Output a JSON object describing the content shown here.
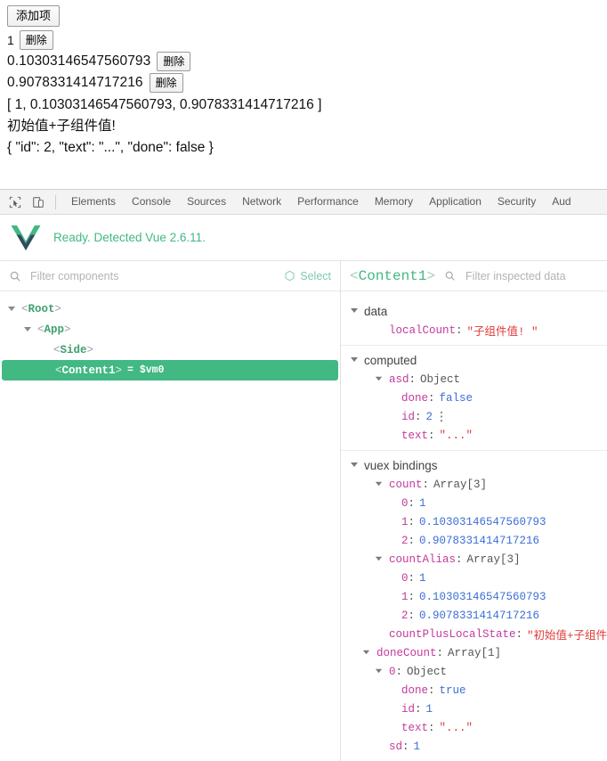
{
  "page": {
    "add_button_label": "添加项",
    "items": [
      {
        "index": "1",
        "value": "",
        "delete_label": "删除"
      },
      {
        "index": "",
        "value": "0.10303146547560793",
        "delete_label": "删除"
      },
      {
        "index": "",
        "value": "0.9078331414717216",
        "delete_label": "删除"
      }
    ],
    "array_line": "[ 1, 0.10303146547560793, 0.9078331414717216 ]",
    "computed_line": "初始值+子组件值!",
    "object_line": "{ \"id\": 2, \"text\": \"...\", \"done\": false }"
  },
  "devtools": {
    "icons": {
      "inspect": "inspect-element-icon",
      "device": "device-toolbar-icon"
    },
    "tabs": [
      {
        "label": "Elements",
        "active": false
      },
      {
        "label": "Console",
        "active": false
      },
      {
        "label": "Sources",
        "active": false
      },
      {
        "label": "Network",
        "active": false
      },
      {
        "label": "Performance",
        "active": false
      },
      {
        "label": "Memory",
        "active": false
      },
      {
        "label": "Application",
        "active": false
      },
      {
        "label": "Security",
        "active": false
      },
      {
        "label": "Aud",
        "active": false
      }
    ]
  },
  "vue_panel": {
    "ready_text": "Ready. Detected Vue 2.6.11.",
    "accent_color": "#42b883",
    "components": {
      "filter_placeholder": "Filter components",
      "select_label": "Select",
      "tree": [
        {
          "label": "Root",
          "depth": 0,
          "expandable": true,
          "selected": false,
          "suffix": ""
        },
        {
          "label": "App",
          "depth": 1,
          "expandable": true,
          "selected": false,
          "suffix": ""
        },
        {
          "label": "Side",
          "depth": 2,
          "expandable": false,
          "selected": false,
          "suffix": ""
        },
        {
          "label": "Content1",
          "depth": 2,
          "expandable": false,
          "selected": true,
          "suffix": "= $vm0"
        }
      ]
    },
    "inspector": {
      "title": "Content1",
      "filter_placeholder": "Filter inspected data",
      "groups": [
        {
          "name": "data",
          "rows": [
            {
              "indent": 1,
              "arrow": "none",
              "key": "localCount",
              "value": "\"子组件值! \"",
              "vtype": "str"
            }
          ]
        },
        {
          "name": "computed",
          "rows": [
            {
              "indent": 1,
              "arrow": "down",
              "key": "asd",
              "value": "Object",
              "vtype": "type"
            },
            {
              "indent": 2,
              "arrow": "none",
              "key": "done",
              "value": "false",
              "vtype": "bool"
            },
            {
              "indent": 2,
              "arrow": "none",
              "key": "id",
              "value": "2",
              "vtype": "num",
              "dots": true
            },
            {
              "indent": 2,
              "arrow": "none",
              "key": "text",
              "value": "\"...\"",
              "vtype": "str"
            }
          ]
        },
        {
          "name": "vuex bindings",
          "rows": [
            {
              "indent": 1,
              "arrow": "down",
              "key": "count",
              "value": "Array[3]",
              "vtype": "type"
            },
            {
              "indent": 2,
              "arrow": "none",
              "key": "0",
              "value": "1",
              "vtype": "num"
            },
            {
              "indent": 2,
              "arrow": "none",
              "key": "1",
              "value": "0.10303146547560793",
              "vtype": "num"
            },
            {
              "indent": 2,
              "arrow": "none",
              "key": "2",
              "value": "0.9078331414717216",
              "vtype": "num"
            },
            {
              "indent": 1,
              "arrow": "down",
              "key": "countAlias",
              "value": "Array[3]",
              "vtype": "type"
            },
            {
              "indent": 2,
              "arrow": "none",
              "key": "0",
              "value": "1",
              "vtype": "num"
            },
            {
              "indent": 2,
              "arrow": "none",
              "key": "1",
              "value": "0.10303146547560793",
              "vtype": "num"
            },
            {
              "indent": 2,
              "arrow": "none",
              "key": "2",
              "value": "0.9078331414717216",
              "vtype": "num"
            },
            {
              "indent": 1,
              "arrow": "none",
              "key": "countPlusLocalState",
              "value": "\"初始值+子组件值! \"",
              "vtype": "str"
            },
            {
              "indent": 0,
              "arrow": "down",
              "key": "doneCount",
              "value": "Array[1]",
              "vtype": "type"
            },
            {
              "indent": 1,
              "arrow": "down",
              "key": "0",
              "value": "Object",
              "vtype": "type"
            },
            {
              "indent": 2,
              "arrow": "none",
              "key": "done",
              "value": "true",
              "vtype": "bool"
            },
            {
              "indent": 2,
              "arrow": "none",
              "key": "id",
              "value": "1",
              "vtype": "num"
            },
            {
              "indent": 2,
              "arrow": "none",
              "key": "text",
              "value": "\"...\"",
              "vtype": "str"
            },
            {
              "indent": 1,
              "arrow": "none",
              "key": "sd",
              "value": "1",
              "vtype": "num"
            }
          ]
        }
      ]
    }
  }
}
